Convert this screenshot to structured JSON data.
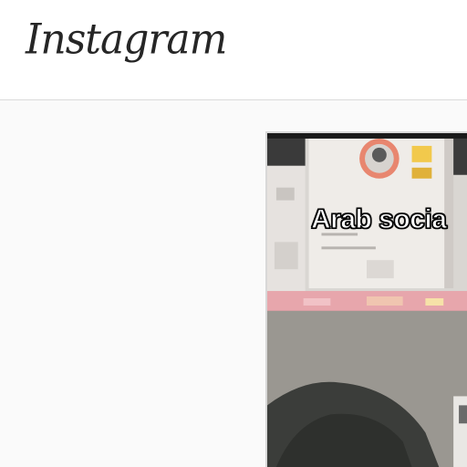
{
  "app": {
    "logo_text": "Instagram"
  },
  "post": {
    "video_caption": "Arab socia"
  },
  "colors": {
    "header_bg": "#ffffff",
    "page_bg": "#fafafa",
    "border": "#dbdbdb"
  }
}
